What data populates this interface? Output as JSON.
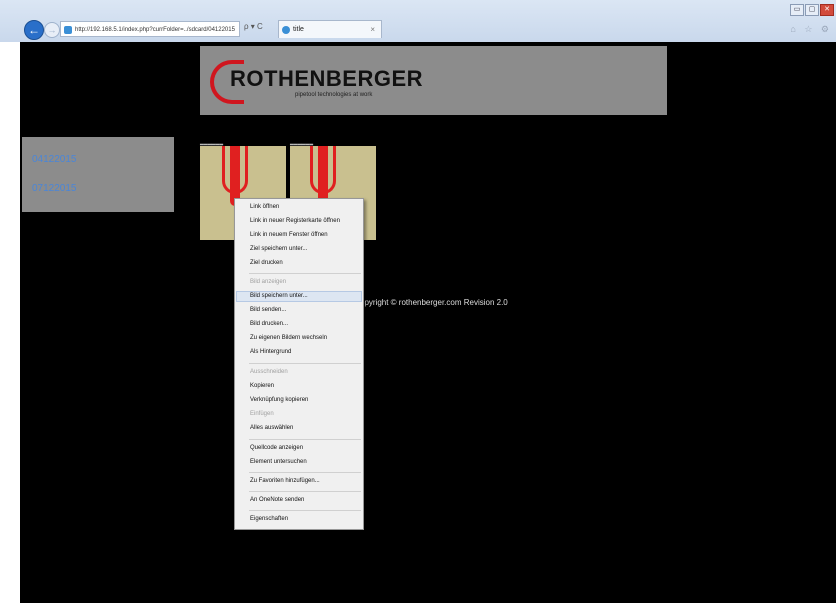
{
  "browser": {
    "url": "http://192.168.5.1/index.php?currFolder=../sdcard/04122015",
    "addr_tools": "ρ ▾ C",
    "tab_title": "title",
    "tab_close": "×",
    "win_min": "▭",
    "win_max": "▢",
    "win_close": "✕",
    "right_icons": "⌂ ☆ ⚙"
  },
  "banner": {
    "brand": "ROTHENBERGER",
    "tagline": "pipetool technologies at work"
  },
  "folders": [
    "04122015",
    "07122015"
  ],
  "thumbnails": [
    {
      "caption": "▂▂▂▂▂▂"
    },
    {
      "caption": "▂▂▂▂▂▂"
    }
  ],
  "footer": {
    "copyright": "opyright © rothenberger.com Revision 2.0"
  },
  "context_menu": {
    "items": [
      {
        "label": "Link öffnen",
        "disabled": false
      },
      {
        "label": "Link in neuer Registerkarte öffnen",
        "disabled": false
      },
      {
        "label": "Link in neuem Fenster öffnen",
        "disabled": false
      },
      {
        "label": "Ziel speichern unter...",
        "disabled": false
      },
      {
        "label": "Ziel drucken",
        "disabled": false
      },
      {
        "label": "Bild anzeigen",
        "disabled": true
      },
      {
        "label": "Bild speichern unter...",
        "disabled": false,
        "hovered": true
      },
      {
        "label": "Bild senden...",
        "disabled": false
      },
      {
        "label": "Bild drucken...",
        "disabled": false
      },
      {
        "label": "Zu eigenen Bildern wechseln",
        "disabled": false
      },
      {
        "label": "Als Hintergrund",
        "disabled": false
      },
      {
        "label": "Ausschneiden",
        "disabled": true
      },
      {
        "label": "Kopieren",
        "disabled": false
      },
      {
        "label": "Verknüpfung kopieren",
        "disabled": false
      },
      {
        "label": "Einfügen",
        "disabled": true
      },
      {
        "label": "Alles auswählen",
        "disabled": false
      },
      {
        "label": "Quellcode anzeigen",
        "disabled": false
      },
      {
        "label": "Element untersuchen",
        "disabled": false
      },
      {
        "label": "Zu Favoriten hinzufügen...",
        "disabled": false
      },
      {
        "label": "An OneNote senden",
        "disabled": false
      },
      {
        "label": "Eigenschaften",
        "disabled": false
      }
    ]
  },
  "colors": {
    "page_background": "#000000",
    "panel_gray": "#8c8c8c",
    "link_blue": "#4a86d8",
    "brand_red": "#d0161f"
  }
}
